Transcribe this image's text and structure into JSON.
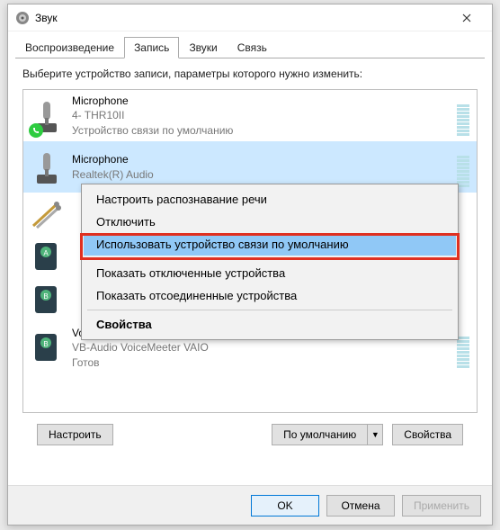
{
  "window": {
    "title": "Звук"
  },
  "tabs": {
    "playback": "Воспроизведение",
    "recording": "Запись",
    "sounds": "Звуки",
    "comms": "Связь"
  },
  "instruction": "Выберите устройство записи, параметры которого нужно изменить:",
  "devices": [
    {
      "name": "Microphone",
      "sub": "4- THR10II",
      "status": "Устройство связи по умолчанию"
    },
    {
      "name": "Microphone",
      "sub": "Realtek(R) Audio",
      "status": ""
    },
    {
      "name": "",
      "sub": "",
      "status": ""
    },
    {
      "name": "",
      "sub": "",
      "status": ""
    },
    {
      "name": "",
      "sub": "",
      "status": ""
    },
    {
      "name": "VoiceMeeter Output",
      "sub": "VB-Audio VoiceMeeter VAIO",
      "status": "Готов"
    }
  ],
  "context_menu": {
    "item0": "Настроить распознавание речи",
    "item1": "Отключить",
    "item2": "Использовать устройство связи по умолчанию",
    "item3": "Показать отключенные устройства",
    "item4": "Показать отсоединенные устройства",
    "item5": "Свойства"
  },
  "buttons": {
    "configure": "Настроить",
    "default": "По умолчанию",
    "properties": "Свойства",
    "ok": "OK",
    "cancel": "Отмена",
    "apply": "Применить"
  }
}
